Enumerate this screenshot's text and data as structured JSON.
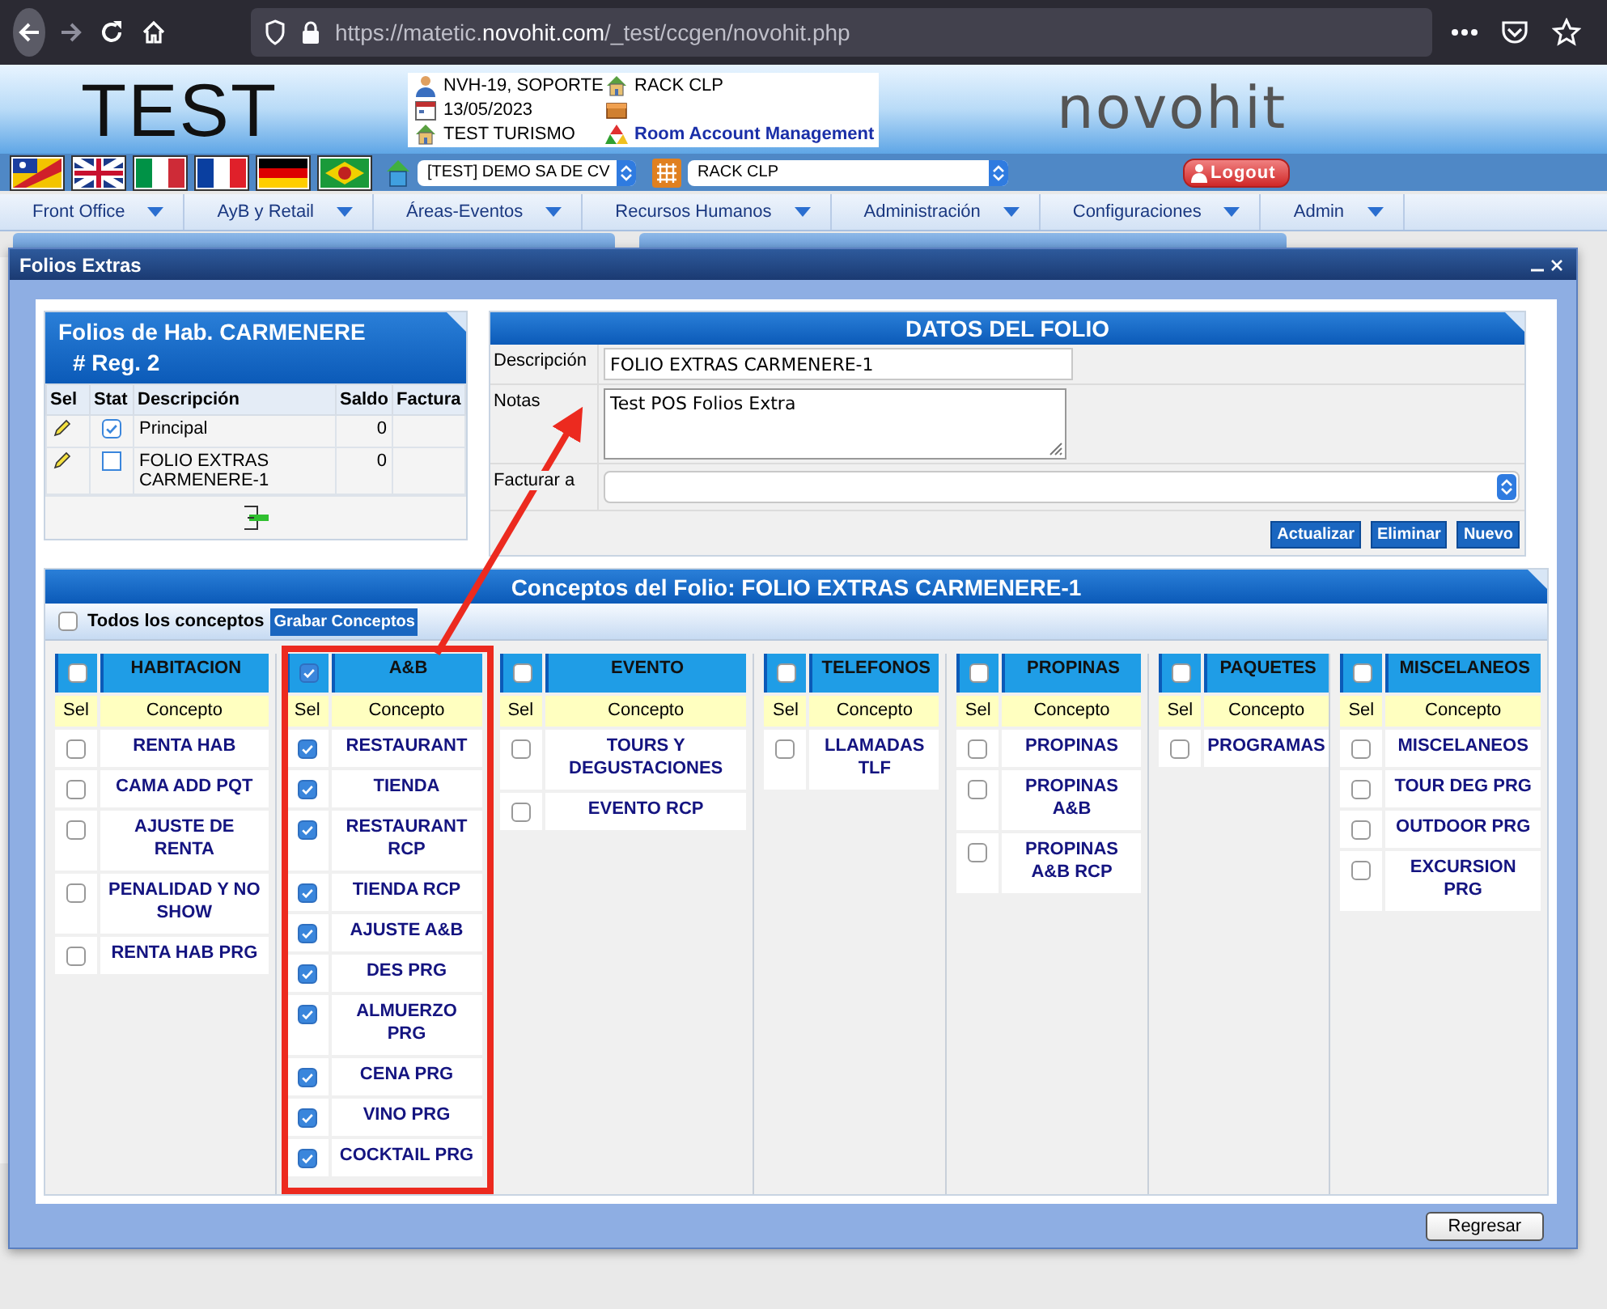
{
  "browser": {
    "url": "https://matetic.**novohit.com**/_test/ccgen/novohit.php"
  },
  "header": {
    "logo": "TEST",
    "brand": "novohit",
    "info": [
      {
        "kind": "user",
        "text": "NVH-19, SOPORTE",
        "highlighted": false
      },
      {
        "kind": "house",
        "text": "RACK CLP",
        "highlighted": false
      },
      {
        "kind": "calendar",
        "text": "13/05/2023",
        "highlighted": false
      },
      {
        "kind": "box"
      },
      {
        "kind": "house",
        "text": "TEST TURISMO",
        "highlighted": false
      },
      {
        "kind": "shapes",
        "text": "Room Account Management",
        "highlighted": true
      }
    ]
  },
  "toolbar": {
    "company": "[TEST] DEMO SA DE CV",
    "property": "RACK CLP",
    "logout": "Logout"
  },
  "menu": [
    "Front Office",
    "AyB y Retail",
    "Áreas-Eventos",
    "Recursos Humanos",
    "Administración",
    "Configuraciones",
    "Admin"
  ],
  "modal": {
    "title": "Folios Extras",
    "folios": {
      "title": "Folios de Hab. CARMENERE",
      "subtitle": "# Reg. 2",
      "columns": [
        "Sel",
        "Stat",
        "Descripción",
        "Saldo",
        "Factura"
      ],
      "rows": [
        {
          "description": "Principal",
          "saldo": "0",
          "checked": true
        },
        {
          "description": "FOLIO EXTRAS CARMENERE-1",
          "saldo": "0",
          "checked": false
        }
      ]
    },
    "datos": {
      "title": "DATOS DEL FOLIO",
      "description_label": "Descripción",
      "description": "FOLIO EXTRAS CARMENERE-1",
      "notes_label": "Notas",
      "notes": "Test POS Folios Extra",
      "bill_to_label": "Facturar a",
      "buttons": [
        "Actualizar",
        "Eliminar",
        "Nuevo"
      ]
    },
    "conceptos": {
      "title": "Conceptos del Folio: FOLIO EXTRAS CARMENERE-1",
      "all_label": "Todos los conceptos",
      "all_checked": false,
      "save": "Grabar Conceptos",
      "categories": [
        {
          "name": "HABITACION",
          "checked": false,
          "sel_label": "Sel",
          "concept_label": "Concepto",
          "items": [
            {
              "label": "RENTA HAB",
              "checked": false
            },
            {
              "label": "CAMA ADD PQT",
              "checked": false
            },
            {
              "label": "AJUSTE DE RENTA",
              "checked": false
            },
            {
              "label": "PENALIDAD Y NO SHOW",
              "checked": false
            },
            {
              "label": "RENTA HAB PRG",
              "checked": false
            }
          ]
        },
        {
          "name": "A&B",
          "checked": true,
          "sel_label": "Sel",
          "concept_label": "Concepto",
          "items": [
            {
              "label": "RESTAURANT",
              "checked": true
            },
            {
              "label": "TIENDA",
              "checked": true
            },
            {
              "label": "RESTAURANT RCP",
              "checked": true
            },
            {
              "label": "TIENDA RCP",
              "checked": true
            },
            {
              "label": "AJUSTE A&B",
              "checked": true
            },
            {
              "label": "DES PRG",
              "checked": true
            },
            {
              "label": "ALMUERZO PRG",
              "checked": true
            },
            {
              "label": "CENA PRG",
              "checked": true
            },
            {
              "label": "VINO PRG",
              "checked": true
            },
            {
              "label": "COCKTAIL PRG",
              "checked": true
            }
          ]
        },
        {
          "name": "EVENTO",
          "checked": false,
          "sel_label": "Sel",
          "concept_label": "Concepto",
          "items": [
            {
              "label": "TOURS Y DEGUSTACIONES",
              "checked": false
            },
            {
              "label": "EVENTO RCP",
              "checked": false
            }
          ]
        },
        {
          "name": "TELEFONOS",
          "checked": false,
          "sel_label": "Sel",
          "concept_label": "Concepto",
          "items": [
            {
              "label": "LLAMADAS TLF",
              "checked": false
            }
          ]
        },
        {
          "name": "PROPINAS",
          "checked": false,
          "sel_label": "Sel",
          "concept_label": "Concepto",
          "items": [
            {
              "label": "PROPINAS",
              "checked": false
            },
            {
              "label": "PROPINAS A&B",
              "checked": false
            },
            {
              "label": "PROPINAS A&B RCP",
              "checked": false
            }
          ]
        },
        {
          "name": "PAQUETES",
          "checked": false,
          "sel_label": "Sel",
          "concept_label": "Concepto",
          "items": [
            {
              "label": "PROGRAMAS",
              "checked": false
            }
          ]
        },
        {
          "name": "MISCELANEOS",
          "checked": false,
          "sel_label": "Sel",
          "concept_label": "Concepto",
          "items": [
            {
              "label": "MISCELANEOS",
              "checked": false
            },
            {
              "label": "TOUR DEG PRG",
              "checked": false
            },
            {
              "label": "OUTDOOR PRG",
              "checked": false
            },
            {
              "label": "EXCURSION PRG",
              "checked": false
            }
          ]
        }
      ]
    },
    "back": "Regresar"
  }
}
